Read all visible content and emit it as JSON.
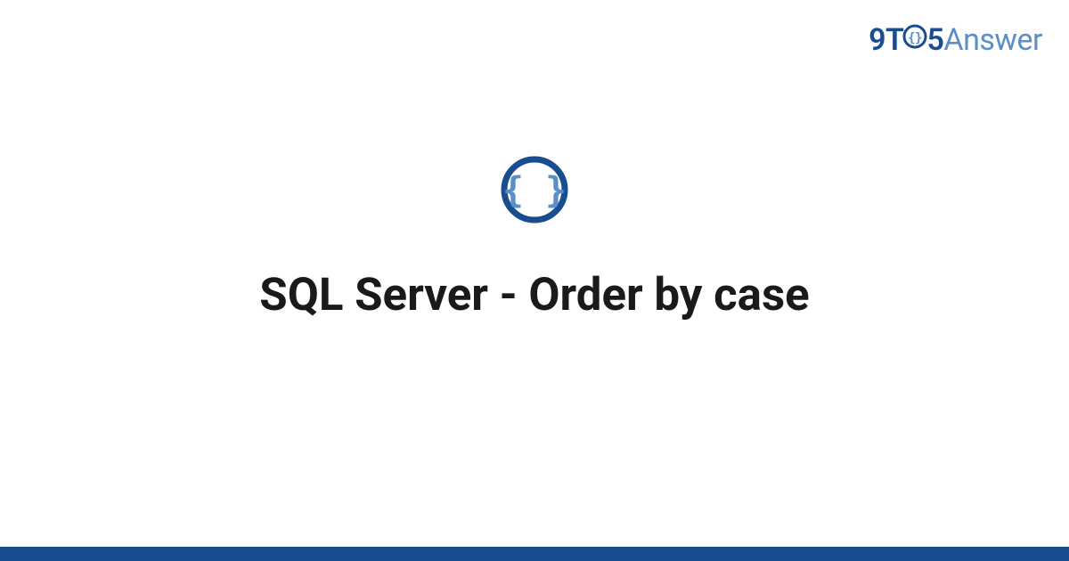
{
  "brand": {
    "part1": "9T",
    "part2": "5",
    "part3": "Answer"
  },
  "title": "SQL Server - Order by case",
  "colors": {
    "brand_dark": "#1a4d8f",
    "brand_light": "#5a8fc7",
    "icon_ring": "#1a4d8f",
    "icon_braces": "#5a8fc7",
    "footer": "#1a4d8f"
  }
}
